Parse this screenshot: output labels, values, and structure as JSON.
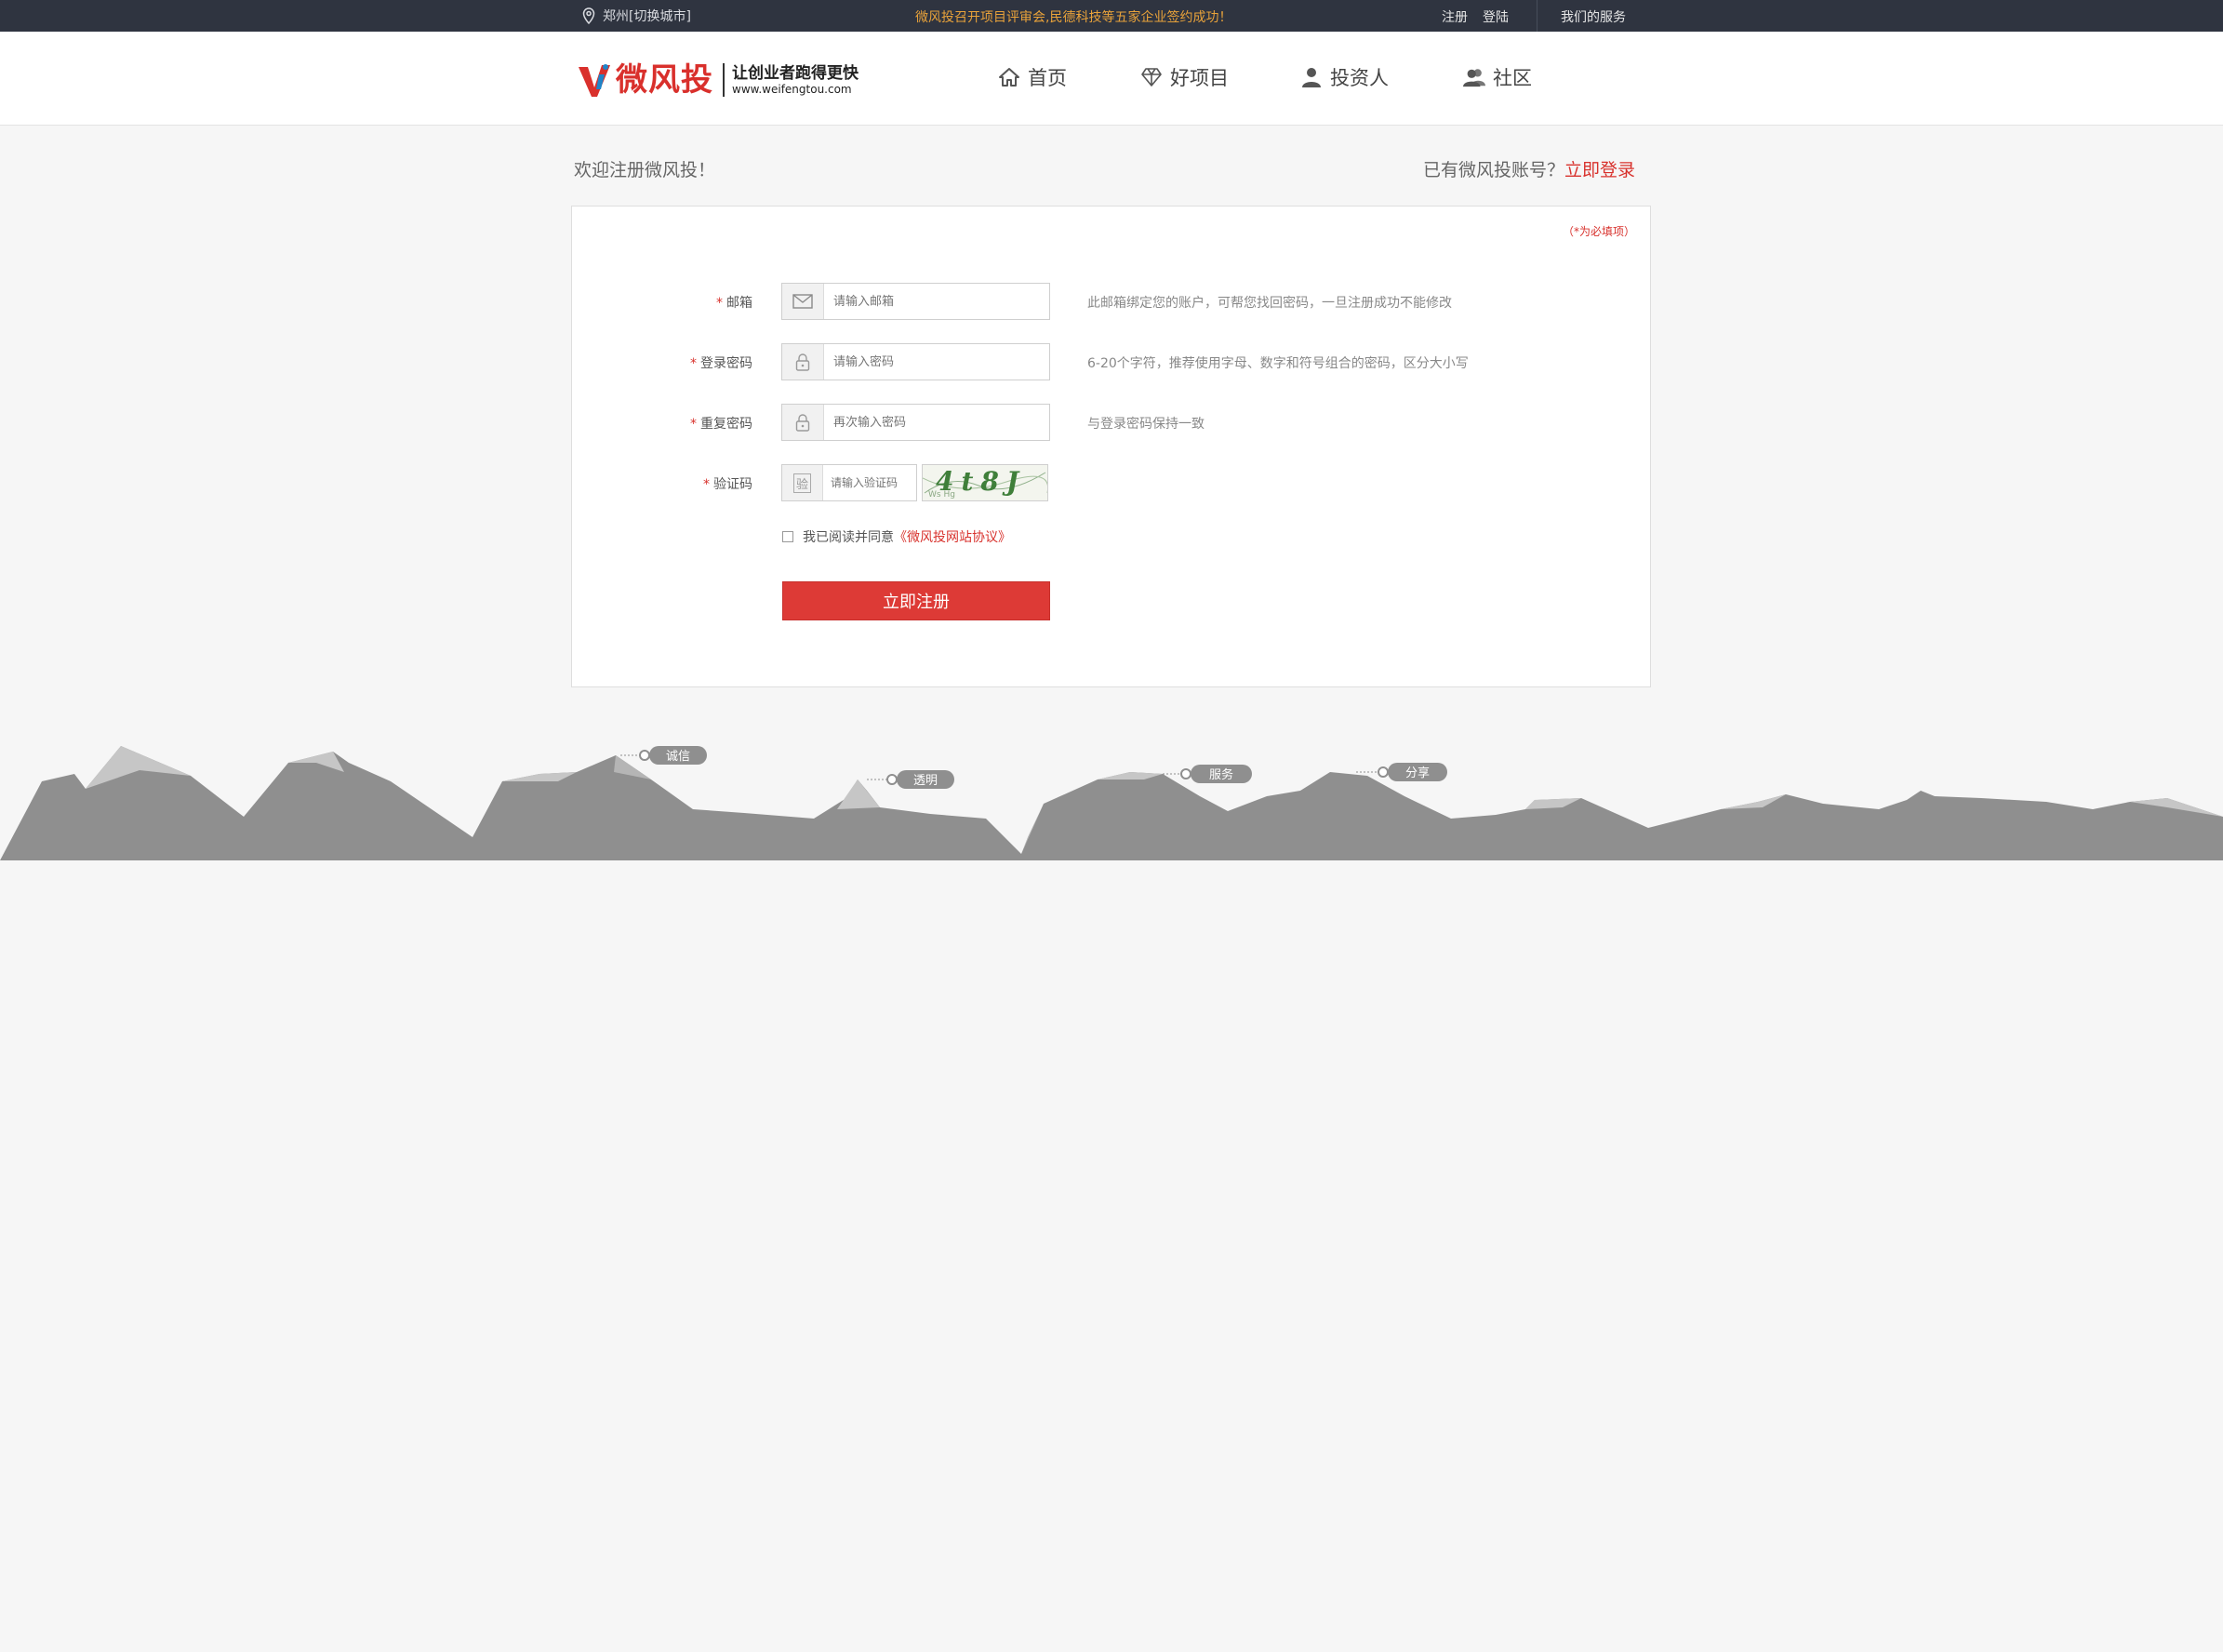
{
  "topbar": {
    "location": "郑州[切换城市]",
    "notice": "微风投召开项目评审会,民德科技等五家企业签约成功！",
    "register": "注册",
    "login": "登陆",
    "services": "我们的服务"
  },
  "logo": {
    "name": "微风投",
    "slogan": "让创业者跑得更快",
    "url": "www.weifengtou.com"
  },
  "nav": [
    {
      "label": "首页",
      "icon": "home-icon"
    },
    {
      "label": "好项目",
      "icon": "diamond-icon"
    },
    {
      "label": "投资人",
      "icon": "user-icon"
    },
    {
      "label": "社区",
      "icon": "users-icon"
    }
  ],
  "page": {
    "welcome": "欢迎注册微风投！",
    "has_account": "已有微风投账号？",
    "login_now": "立即登录"
  },
  "form": {
    "required_note": "（*为必填项）",
    "required_mark": "*",
    "email": {
      "label": "邮箱",
      "placeholder": "请输入邮箱",
      "hint": "此邮箱绑定您的账户，可帮您找回密码，一旦注册成功不能修改"
    },
    "password": {
      "label": "登录密码",
      "placeholder": "请输入密码",
      "hint": "6-20个字符，推荐使用字母、数字和符号组合的密码，区分大小写"
    },
    "confirm": {
      "label": "重复密码",
      "placeholder": "再次输入密码",
      "hint": "与登录密码保持一致"
    },
    "captcha": {
      "label": "验证码",
      "placeholder": "请输入验证码",
      "icon_text": "验",
      "image_text": "4t8J"
    },
    "agree_text": "我已阅读并同意",
    "agreement_link": "《微风投网站协议》",
    "submit": "立即注册"
  },
  "footer_tags": [
    "诚信",
    "透明",
    "服务",
    "分享"
  ],
  "colors": {
    "accent": "#dd3a36",
    "topbar": "#2f3440",
    "notice": "#e8a23a",
    "mountain": "#8f8f8f"
  }
}
